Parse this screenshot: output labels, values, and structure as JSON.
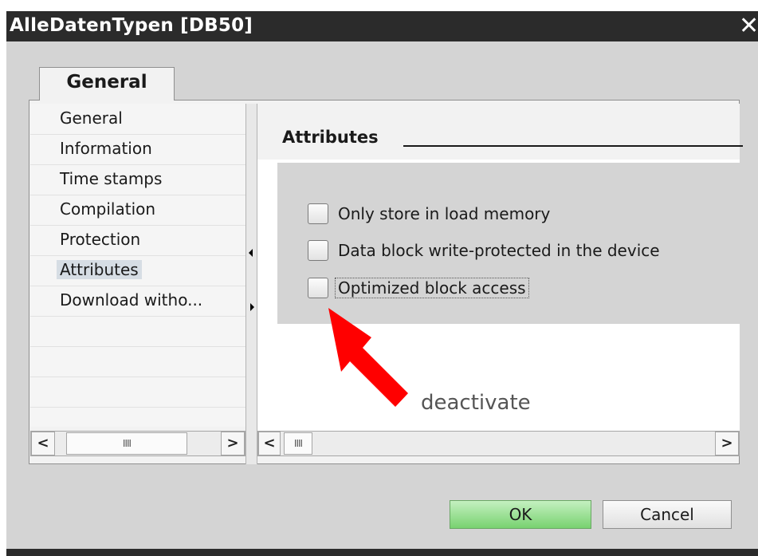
{
  "window": {
    "title": "AlleDatenTypen [DB50]",
    "close_glyph": "✕"
  },
  "tab": {
    "label": "General"
  },
  "nav": {
    "items": [
      {
        "label": "General",
        "selected": false
      },
      {
        "label": "Information",
        "selected": false
      },
      {
        "label": "Time stamps",
        "selected": false
      },
      {
        "label": "Compilation",
        "selected": false
      },
      {
        "label": "Protection",
        "selected": false
      },
      {
        "label": "Attributes",
        "selected": true
      },
      {
        "label": "Download witho...",
        "selected": false
      }
    ],
    "scroll_left": "<",
    "scroll_right": ">",
    "scroll_thumb": "IIII"
  },
  "panel": {
    "title": "Attributes",
    "checkboxes": [
      {
        "label": "Only store in load memory",
        "checked": false
      },
      {
        "label": "Data block write-protected in the device",
        "checked": false
      },
      {
        "label": "Optimized block access",
        "checked": false
      }
    ],
    "scroll_left": "<",
    "scroll_right": ">",
    "scroll_thumb": "IIII"
  },
  "annotation": {
    "text": "deactivate",
    "color": "#ff0000"
  },
  "buttons": {
    "ok": "OK",
    "cancel": "Cancel"
  }
}
